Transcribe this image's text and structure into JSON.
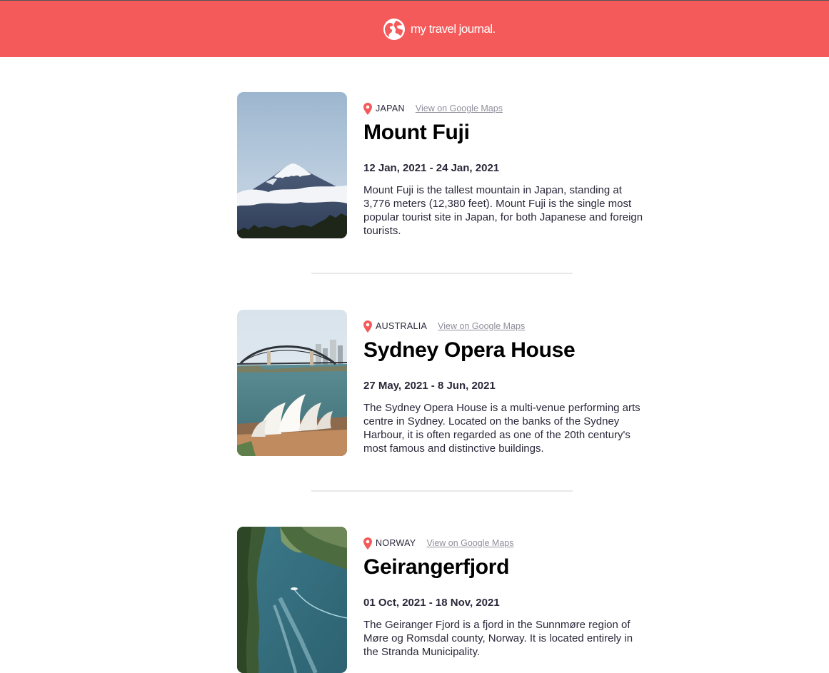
{
  "header": {
    "brand": "my travel journal.",
    "icon": "globe-icon"
  },
  "entries": [
    {
      "country": "JAPAN",
      "maps_link": "View on Google Maps",
      "title": "Mount Fuji",
      "dates": "12 Jan, 2021 - 24 Jan, 2021",
      "description": "Mount Fuji is the tallest mountain in Japan, standing at 3,776 meters (12,380 feet). Mount Fuji is the single most popular tourist site in Japan, for both Japanese and foreign tourists."
    },
    {
      "country": "AUSTRALIA",
      "maps_link": "View on Google Maps",
      "title": "Sydney Opera House",
      "dates": "27 May, 2021 - 8 Jun, 2021",
      "description": "The Sydney Opera House is a multi-venue performing arts centre in Sydney. Located on the banks of the Sydney Harbour, it is often regarded as one of the 20th century's most famous and distinctive buildings."
    },
    {
      "country": "NORWAY",
      "maps_link": "View on Google Maps",
      "title": "Geirangerfjord",
      "dates": "01 Oct, 2021 - 18 Nov, 2021",
      "description": "The Geiranger Fjord is a fjord in the Sunnmøre region of Møre og Romsdal county, Norway. It is located entirely in the Stranda Municipality."
    }
  ],
  "colors": {
    "accent": "#F55A5A",
    "text": "#2B283A",
    "link": "#918E9B",
    "divider": "#E8E8E8"
  }
}
